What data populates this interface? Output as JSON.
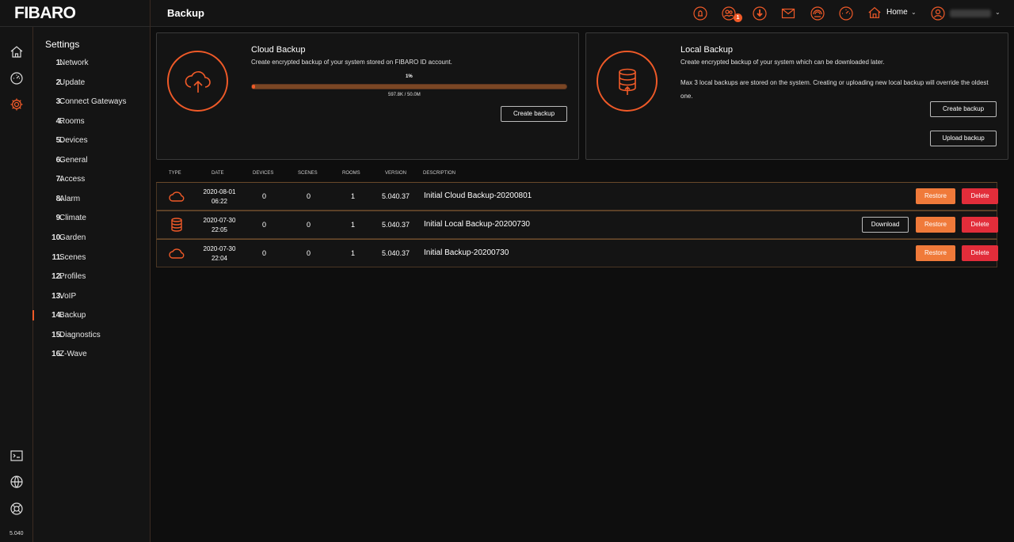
{
  "app": {
    "logo": "FIBARO",
    "version": "5.040"
  },
  "header": {
    "title": "Backup",
    "notification_count": "1",
    "home_label": "Home",
    "icons": [
      "alarm-icon",
      "users-icon",
      "download-icon",
      "mail-icon",
      "weather-icon",
      "gauge-icon",
      "home-icon",
      "user-icon"
    ],
    "accent_color": "#f05a28"
  },
  "rail": {
    "icons": [
      "home-icon",
      "dashboard-icon",
      "settings-icon",
      "terminal-icon",
      "network-icon",
      "help-icon"
    ]
  },
  "nav": {
    "title": "Settings",
    "items": [
      {
        "num": "1.",
        "label": "Network"
      },
      {
        "num": "2.",
        "label": "Update"
      },
      {
        "num": "3.",
        "label": "Connect Gateways"
      },
      {
        "num": "4.",
        "label": "Rooms"
      },
      {
        "num": "5.",
        "label": "Devices"
      },
      {
        "num": "6.",
        "label": "General"
      },
      {
        "num": "7.",
        "label": "Access"
      },
      {
        "num": "8.",
        "label": "Alarm"
      },
      {
        "num": "9.",
        "label": "Climate"
      },
      {
        "num": "10.",
        "label": "Garden"
      },
      {
        "num": "11.",
        "label": "Scenes"
      },
      {
        "num": "12.",
        "label": "Profiles"
      },
      {
        "num": "13.",
        "label": "VoIP"
      },
      {
        "num": "14.",
        "label": "Backup"
      },
      {
        "num": "15.",
        "label": "Diagnostics"
      },
      {
        "num": "16.",
        "label": "Z-Wave"
      }
    ],
    "active_index": 13
  },
  "cloud": {
    "title": "Cloud Backup",
    "desc": "Create encrypted backup of your system stored on FIBARO ID account.",
    "progress_pct_label": "1%",
    "progress_fraction": 0.01,
    "progress_size": "597.8K / 50.0M",
    "create_label": "Create backup"
  },
  "local": {
    "title": "Local Backup",
    "desc": "Create encrypted backup of your system which can be downloaded later.",
    "desc2": "Max 3 local backups are stored on the system. Creating or uploading new local backup will override the oldest one.",
    "create_label": "Create backup",
    "upload_label": "Upload backup"
  },
  "table": {
    "columns": [
      "Type",
      "Date",
      "Devices",
      "Scenes",
      "Rooms",
      "Version",
      "Description"
    ],
    "rows": [
      {
        "type": "cloud",
        "date": "2020-08-01",
        "time": "06:22",
        "devices": "0",
        "scenes": "0",
        "rooms": "1",
        "version": "5.040.37",
        "description": "Initial Cloud Backup-20200801"
      },
      {
        "type": "local",
        "date": "2020-07-30",
        "time": "22:05",
        "devices": "0",
        "scenes": "0",
        "rooms": "1",
        "version": "5.040.37",
        "description": "Initial Local Backup-20200730"
      },
      {
        "type": "cloud",
        "date": "2020-07-30",
        "time": "22:04",
        "devices": "0",
        "scenes": "0",
        "rooms": "1",
        "version": "5.040.37",
        "description": "Initial Backup-20200730"
      }
    ],
    "restore_label": "Restore",
    "delete_label": "Delete",
    "download_label": "Download"
  }
}
